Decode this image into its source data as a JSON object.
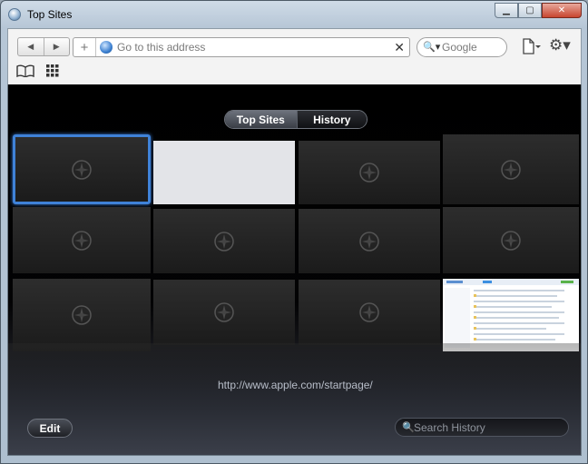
{
  "window": {
    "title": "Top Sites"
  },
  "window_buttons": {
    "minimize": "▁",
    "maximize": "▢",
    "close": "✕"
  },
  "toolbar": {
    "back_glyph": "◀",
    "forward_glyph": "▶",
    "add_glyph": "+",
    "address_placeholder": "Go to this address",
    "clear_glyph": "✕",
    "search_placeholder": "Google",
    "search_glyph": "🔍▾",
    "gear_glyph": "⚙▾"
  },
  "top_sites": {
    "tabs": [
      {
        "label": "Top Sites",
        "selected": true
      },
      {
        "label": "History",
        "selected": false
      }
    ],
    "tiles": [
      {
        "kind": "empty",
        "selected": true
      },
      {
        "kind": "blank"
      },
      {
        "kind": "empty"
      },
      {
        "kind": "empty"
      },
      {
        "kind": "empty"
      },
      {
        "kind": "empty"
      },
      {
        "kind": "empty"
      },
      {
        "kind": "empty"
      },
      {
        "kind": "empty"
      },
      {
        "kind": "empty"
      },
      {
        "kind": "empty"
      },
      {
        "kind": "screenshot"
      }
    ],
    "url": "http://www.apple.com/startpage/",
    "edit_label": "Edit",
    "history_search_placeholder": "Search History",
    "history_search_glyph": "🔍"
  },
  "colors": {
    "selection": "#3f82d8",
    "content_bg": "#000000"
  }
}
